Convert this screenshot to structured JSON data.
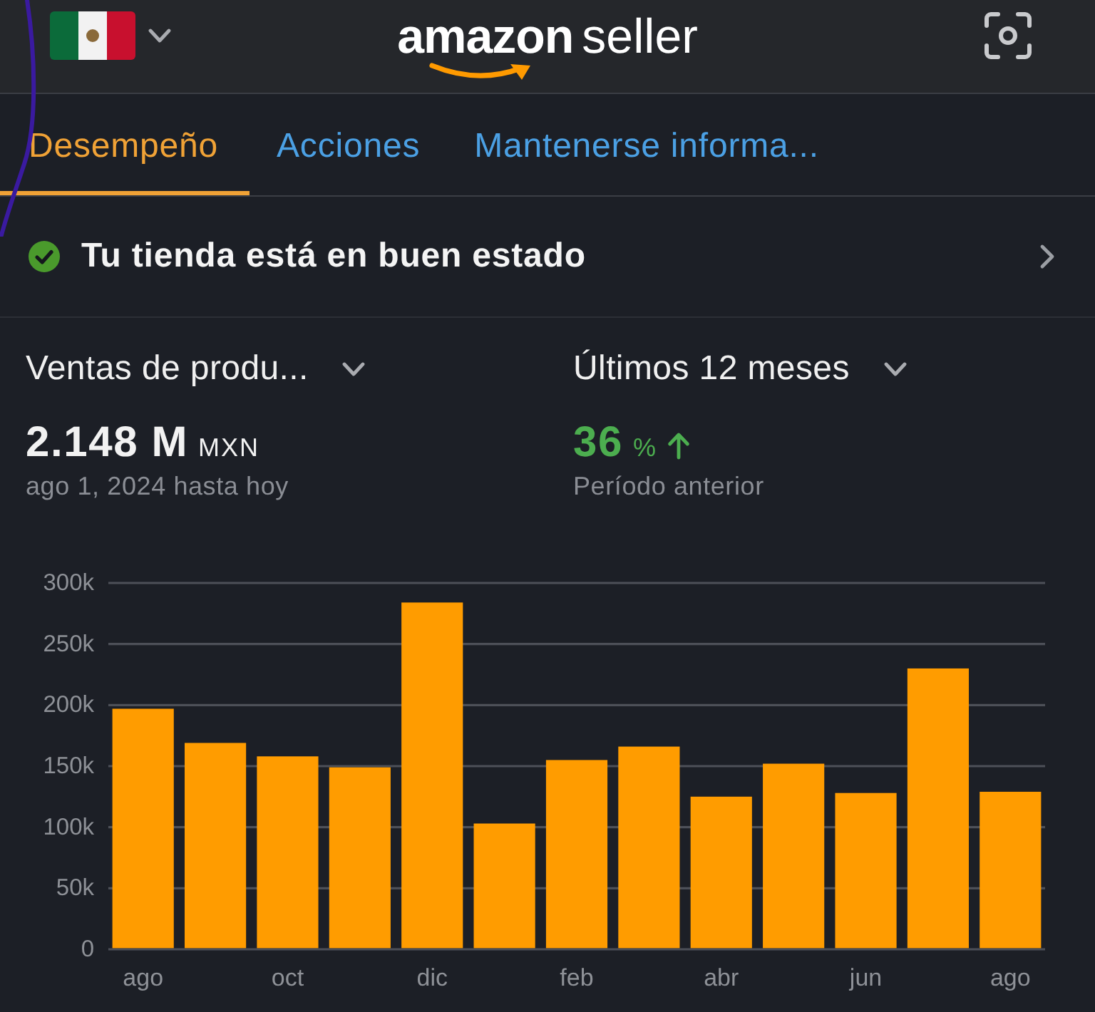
{
  "header": {
    "logo": {
      "brand": "amazon",
      "product": "seller"
    }
  },
  "tabs": [
    {
      "label": "Desempeño",
      "selected": true
    },
    {
      "label": "Acciones",
      "selected": false
    },
    {
      "label": "Mantenerse informa...",
      "selected": false
    }
  ],
  "store_status": {
    "text": "Tu tienda está en buen estado",
    "healthy": true
  },
  "metrics": [
    {
      "label": "Ventas de produ...",
      "value": "2.148 M",
      "unit": "MXN",
      "caption": "ago 1, 2024 hasta hoy"
    },
    {
      "label": "Últimos 12 meses",
      "value": "36",
      "unit": "%",
      "rising": true,
      "caption": "Período anterior"
    }
  ],
  "chart": {
    "chart_data": {
      "type": "bar",
      "grid": true,
      "categories": [
        "ago",
        null,
        "oct",
        null,
        "dic",
        null,
        "feb",
        null,
        "abr",
        null,
        "jun",
        null,
        "ago"
      ],
      "values": [
        197000,
        169000,
        158000,
        149000,
        284000,
        103000,
        155000,
        166000,
        125000,
        152000,
        128000,
        230000,
        129000
      ],
      "ylim": [
        0,
        300000
      ],
      "yticks": [
        {
          "value": 0,
          "label": "0"
        },
        {
          "value": 50000,
          "label": "50k"
        },
        {
          "value": 100000,
          "label": "100k"
        },
        {
          "value": 150000,
          "label": "150k"
        },
        {
          "value": 200000,
          "label": "200k"
        },
        {
          "value": 250000,
          "label": "250k"
        },
        {
          "value": 300000,
          "label": "300k"
        }
      ]
    }
  }
}
